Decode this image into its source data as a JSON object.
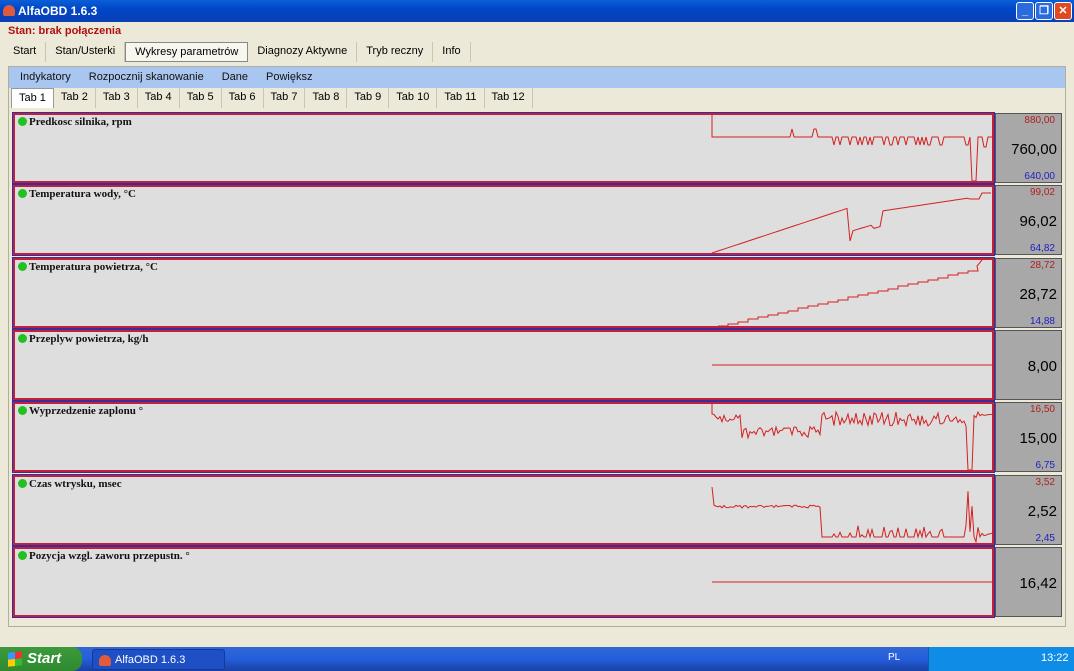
{
  "window": {
    "title": "AlfaOBD 1.6.3"
  },
  "status": "Stan: brak połączenia",
  "main_menu": [
    "Start",
    "Stan/Usterki",
    "Wykresy parametrów",
    "Diagnozy Aktywne",
    "Tryb reczny",
    "Info"
  ],
  "main_menu_active": 2,
  "sub_menu": [
    "Indykatory",
    "Rozpocznij skanowanie",
    "Dane",
    "Powiększ"
  ],
  "tabs": [
    "Tab 1",
    "Tab 2",
    "Tab 3",
    "Tab 4",
    "Tab 5",
    "Tab 6",
    "Tab 7",
    "Tab 8",
    "Tab 9",
    "Tab 10",
    "Tab 11",
    "Tab 12"
  ],
  "active_tab": 0,
  "panels": [
    {
      "label": "Predkosc silnika, rpm",
      "max": "880,00",
      "value": "760,00",
      "min": "640,00"
    },
    {
      "label": "Temperatura wody, °C",
      "max": "99,02",
      "value": "96,02",
      "min": "64,82"
    },
    {
      "label": "Temperatura powietrza, °C",
      "max": "28,72",
      "value": "28,72",
      "min": "14,88"
    },
    {
      "label": "Przeplyw powietrza, kg/h",
      "max": "",
      "value": "8,00",
      "min": ""
    },
    {
      "label": "Wyprzedzenie zaplonu °",
      "max": "16,50",
      "value": "15,00",
      "min": "6,75"
    },
    {
      "label": "Czas wtrysku, msec",
      "max": "3,52",
      "value": "2,52",
      "min": "2,45"
    },
    {
      "label": "Pozycja wzgl. zaworu przepustn. °",
      "max": "",
      "value": "16,42",
      "min": ""
    }
  ],
  "colors": {
    "trace": "#d42020",
    "panel_border": "#c41e3a",
    "status": "#b01010"
  },
  "taskbar": {
    "start": "Start",
    "task": "AlfaOBD 1.6.3",
    "lang": "PL",
    "clock": "13:22"
  }
}
